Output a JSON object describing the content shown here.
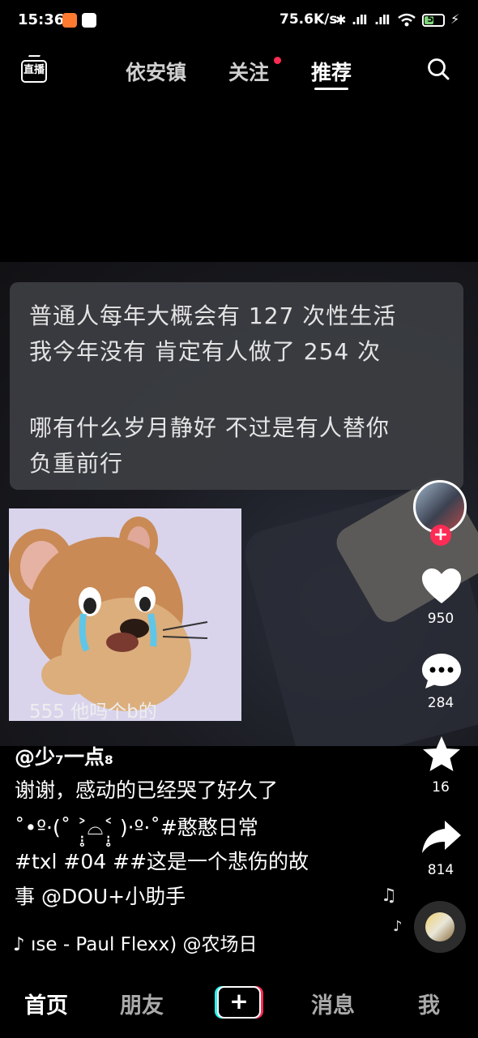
{
  "status_bar": {
    "time": "15:36",
    "network_rate": "75.6K/s",
    "bluetooth_icon": "✱",
    "signal1": ".ıll",
    "signal2": ".ıll",
    "battery": "52",
    "battery_level": 0.52,
    "charging_icon": "⚡"
  },
  "top_nav": {
    "tabs": [
      "依安镇",
      "关注",
      "推荐"
    ],
    "active_tab": "推荐",
    "live_label": "直播",
    "has_notification_dot": true
  },
  "video": {
    "caption_lines": [
      "普通人每年大概会有 127 次性生活",
      "我今年没有 肯定有人做了 254 次",
      "哪有什么岁月静好 不过是有人替你",
      "负重前行"
    ],
    "meme_text": "555    他吗个b的"
  },
  "right_rail": {
    "follow_symbol": "+",
    "likes": "950",
    "comments": "284",
    "favorites": "16",
    "shares": "814"
  },
  "post": {
    "author": "@少₇一点₈",
    "description_lines": [
      "谢谢，感动的已经哭了好久了",
      "˚•º·(˚ ˃̣̣̥⌓˂̣̣̥ )‧º·˚#憨憨日常",
      "#txl #04 ##这是一个悲伤的故",
      "事 @DOU+小助手"
    ],
    "music": "♪ ıse - Paul Flexx)      @农场日"
  },
  "bottom_nav": {
    "items": [
      "首页",
      "朋友",
      "消息",
      "我"
    ],
    "plus": "+",
    "active": "首页"
  },
  "colors": {
    "accent_red": "#fe2c55",
    "accent_cyan": "#25f4ee",
    "battery_green": "#7dd47a"
  }
}
